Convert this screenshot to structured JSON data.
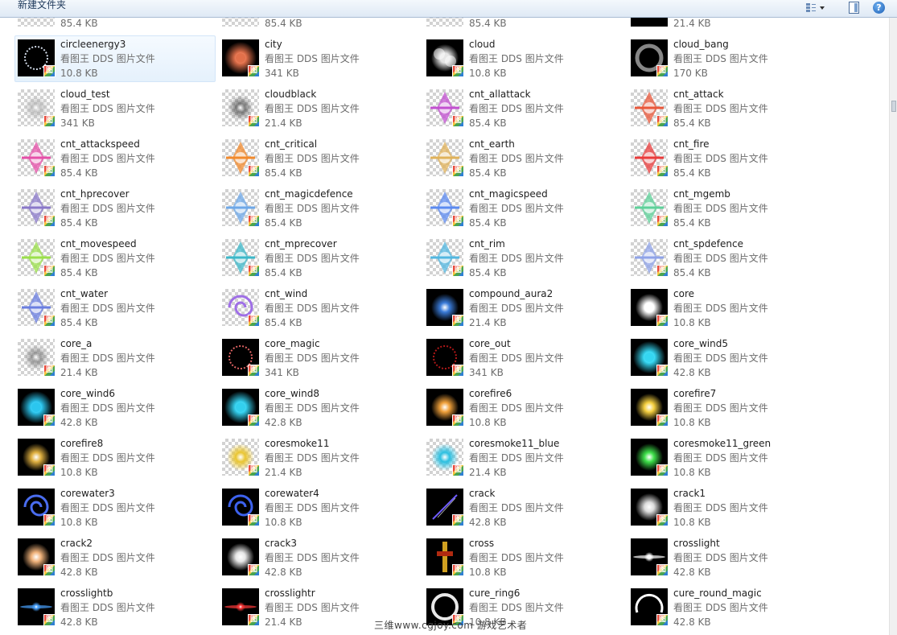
{
  "toolbar": {
    "new_folder_label": "新建文件夹",
    "view_icon": "view-options-icon",
    "pane_icon": "preview-pane-icon",
    "help_icon": "help-icon",
    "help_glyph": "?"
  },
  "file_type": "看图王 DDS 图片文件",
  "badge_glyph": "图",
  "top_row_sizes": [
    "85.4 KB",
    "85.4 KB",
    "85.4 KB",
    "21.4 KB"
  ],
  "files": [
    {
      "name": "circleenergy3",
      "size": "10.8 KB",
      "bg": "dark",
      "fx": "ring",
      "color": "#cfd8e6",
      "selected": true
    },
    {
      "name": "city",
      "size": "341 KB",
      "bg": "dark",
      "fx": "sun",
      "color": "#e2704a"
    },
    {
      "name": "cloud",
      "size": "10.8 KB",
      "bg": "dark",
      "fx": "cloud",
      "color": "#ffffff"
    },
    {
      "name": "cloud_bang",
      "size": "170 KB",
      "bg": "dark",
      "fx": "cloudring",
      "color": "#e0e0e0"
    },
    {
      "name": "cloud_test",
      "size": "341 KB",
      "bg": "checker",
      "fx": "smudge",
      "color": "#b0b0b0"
    },
    {
      "name": "cloudblack",
      "size": "21.4 KB",
      "bg": "checker",
      "fx": "smudge",
      "color": "#4a4a4a"
    },
    {
      "name": "cnt_allattack",
      "size": "85.4 KB",
      "bg": "checker",
      "fx": "sprite",
      "color": "#c24fd0"
    },
    {
      "name": "cnt_attack",
      "size": "85.4 KB",
      "bg": "checker",
      "fx": "sprite",
      "color": "#e9573a"
    },
    {
      "name": "cnt_attackspeed",
      "size": "85.4 KB",
      "bg": "checker",
      "fx": "sprite",
      "color": "#e54fa8"
    },
    {
      "name": "cnt_critical",
      "size": "85.4 KB",
      "bg": "checker",
      "fx": "sprite",
      "color": "#f28a2c"
    },
    {
      "name": "cnt_earth",
      "size": "85.4 KB",
      "bg": "checker",
      "fx": "sprite",
      "color": "#e0b25a"
    },
    {
      "name": "cnt_fire",
      "size": "85.4 KB",
      "bg": "checker",
      "fx": "sprite",
      "color": "#ea3b3b"
    },
    {
      "name": "cnt_hprecover",
      "size": "85.4 KB",
      "bg": "checker",
      "fx": "sprite",
      "color": "#8a78c9"
    },
    {
      "name": "cnt_magicdefence",
      "size": "85.4 KB",
      "bg": "checker",
      "fx": "sprite",
      "color": "#6ea8e8"
    },
    {
      "name": "cnt_magicspeed",
      "size": "85.4 KB",
      "bg": "checker",
      "fx": "sprite",
      "color": "#5b8af0"
    },
    {
      "name": "cnt_mgemb",
      "size": "85.4 KB",
      "bg": "checker",
      "fx": "sprite",
      "color": "#5ed19a"
    },
    {
      "name": "cnt_movespeed",
      "size": "85.4 KB",
      "bg": "checker",
      "fx": "sprite",
      "color": "#9be04b"
    },
    {
      "name": "cnt_mprecover",
      "size": "85.4 KB",
      "bg": "checker",
      "fx": "sprite",
      "color": "#3cb8c9"
    },
    {
      "name": "cnt_rim",
      "size": "85.4 KB",
      "bg": "checker",
      "fx": "sprite",
      "color": "#52b7e0"
    },
    {
      "name": "cnt_spdefence",
      "size": "85.4 KB",
      "bg": "checker",
      "fx": "sprite",
      "color": "#8fa3e8"
    },
    {
      "name": "cnt_water",
      "size": "85.4 KB",
      "bg": "checker",
      "fx": "sprite",
      "color": "#6a7ee0"
    },
    {
      "name": "cnt_wind",
      "size": "85.4 KB",
      "bg": "checker",
      "fx": "swirl",
      "color": "#9f6fe6"
    },
    {
      "name": "compound_aura2",
      "size": "21.4 KB",
      "bg": "dark",
      "fx": "glow",
      "color": "#3a7bd8"
    },
    {
      "name": "core",
      "size": "10.8 KB",
      "bg": "dark",
      "fx": "glow",
      "color": "#ffffff"
    },
    {
      "name": "core_a",
      "size": "21.4 KB",
      "bg": "checker",
      "fx": "smudge",
      "color": "#777777"
    },
    {
      "name": "core_magic",
      "size": "341 KB",
      "bg": "dark",
      "fx": "ring",
      "color": "#e06464"
    },
    {
      "name": "core_out",
      "size": "341 KB",
      "bg": "dark",
      "fx": "ring",
      "color": "#b01818"
    },
    {
      "name": "core_wind5",
      "size": "42.8 KB",
      "bg": "dark",
      "fx": "sun",
      "color": "#34d6f2"
    },
    {
      "name": "core_wind6",
      "size": "42.8 KB",
      "bg": "dark",
      "fx": "sun",
      "color": "#2bc6ef"
    },
    {
      "name": "core_wind8",
      "size": "42.8 KB",
      "bg": "dark",
      "fx": "sun",
      "color": "#33d0ef"
    },
    {
      "name": "corefire6",
      "size": "10.8 KB",
      "bg": "dark",
      "fx": "glow",
      "color": "#f0a03a"
    },
    {
      "name": "corefire7",
      "size": "10.8 KB",
      "bg": "dark",
      "fx": "glow",
      "color": "#f6d040"
    },
    {
      "name": "corefire8",
      "size": "10.8 KB",
      "bg": "dark",
      "fx": "glow",
      "color": "#e0b040"
    },
    {
      "name": "coresmoke11",
      "size": "21.4 KB",
      "bg": "checker",
      "fx": "glow",
      "color": "#e9c531"
    },
    {
      "name": "coresmoke11_blue",
      "size": "21.4 KB",
      "bg": "checker",
      "fx": "glow",
      "color": "#2bbfe0"
    },
    {
      "name": "coresmoke11_green",
      "size": "10.8 KB",
      "bg": "dark",
      "fx": "glow",
      "color": "#3ee04a"
    },
    {
      "name": "corewater3",
      "size": "10.8 KB",
      "bg": "dark",
      "fx": "swirl",
      "color": "#4a6df0"
    },
    {
      "name": "corewater4",
      "size": "10.8 KB",
      "bg": "dark",
      "fx": "swirl",
      "color": "#3d62ee"
    },
    {
      "name": "crack",
      "size": "42.8 KB",
      "bg": "dark",
      "fx": "streak",
      "color": "#6f5cff"
    },
    {
      "name": "crack1",
      "size": "10.8 KB",
      "bg": "dark",
      "fx": "glow",
      "color": "#dddddd"
    },
    {
      "name": "crack2",
      "size": "42.8 KB",
      "bg": "dark",
      "fx": "glow",
      "color": "#f0b27a"
    },
    {
      "name": "crack3",
      "size": "42.8 KB",
      "bg": "dark",
      "fx": "glow",
      "color": "#e6e6e6"
    },
    {
      "name": "cross",
      "size": "10.8 KB",
      "bg": "dark",
      "fx": "cross",
      "color": "#d0a020"
    },
    {
      "name": "crosslight",
      "size": "42.8 KB",
      "bg": "dark",
      "fx": "flare",
      "color": "#ffffff"
    },
    {
      "name": "crosslightb",
      "size": "42.8 KB",
      "bg": "dark",
      "fx": "flare",
      "color": "#4aa3ff"
    },
    {
      "name": "crosslightr",
      "size": "21.4 KB",
      "bg": "dark",
      "fx": "flare",
      "color": "#ff3a3a"
    },
    {
      "name": "cure_ring6",
      "size": "10.8 KB",
      "bg": "dark",
      "fx": "bigring",
      "color": "#e8e8e8"
    },
    {
      "name": "cure_round_magic",
      "size": "42.8 KB",
      "bg": "dark",
      "fx": "arc",
      "color": "#ffffff"
    }
  ],
  "watermark": "三维www.cgjoy.com 游戏艺术者"
}
